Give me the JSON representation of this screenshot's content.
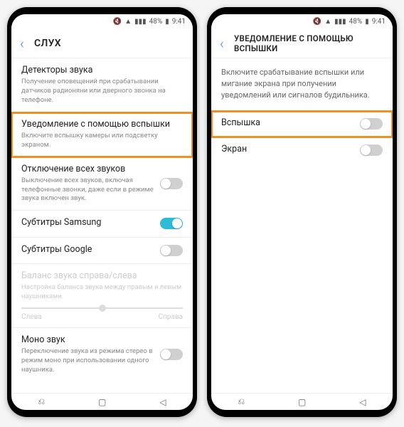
{
  "status": {
    "mute": "🔇",
    "wifi": "▲",
    "signal": "📶",
    "battery_pct": "48%",
    "time": "9:41"
  },
  "left": {
    "title": "СЛУХ",
    "items": [
      {
        "title": "Детекторы звука",
        "desc": "Получение оповещений при срабатывании датчиков радионяни или дверного звонка на телефоне."
      },
      {
        "title": "Уведомление с помощью вспышки",
        "desc": "Включите вспышку камеры или подсветку экраном."
      },
      {
        "title": "Отключение всех звуков",
        "desc": "Выключение всех звуков, включая телефонные звонки, даже если в режиме звука включен звук."
      },
      {
        "title": "Субтитры Samsung"
      },
      {
        "title": "Субтитры Google"
      },
      {
        "title": "Баланс звука справа/слева",
        "desc": "Настройка баланса звука между правым и левым наушниками.",
        "left_label": "Слева",
        "right_label": "Справа"
      },
      {
        "title": "Моно звук",
        "desc": "Переключение звука из режима стерео в режим моно при использовании одного наушника."
      }
    ]
  },
  "right": {
    "title": "УВЕДОМЛЕНИЕ С ПОМОЩЬЮ ВСПЫШКИ",
    "desc": "Включите срабатывание вспышки или мигание экрана при получении уведомлений или сигналов будильника.",
    "items": [
      {
        "title": "Вспышка"
      },
      {
        "title": "Экран"
      }
    ]
  },
  "nav": {
    "recent": "⌂",
    "home": "◻",
    "back": "◁"
  }
}
